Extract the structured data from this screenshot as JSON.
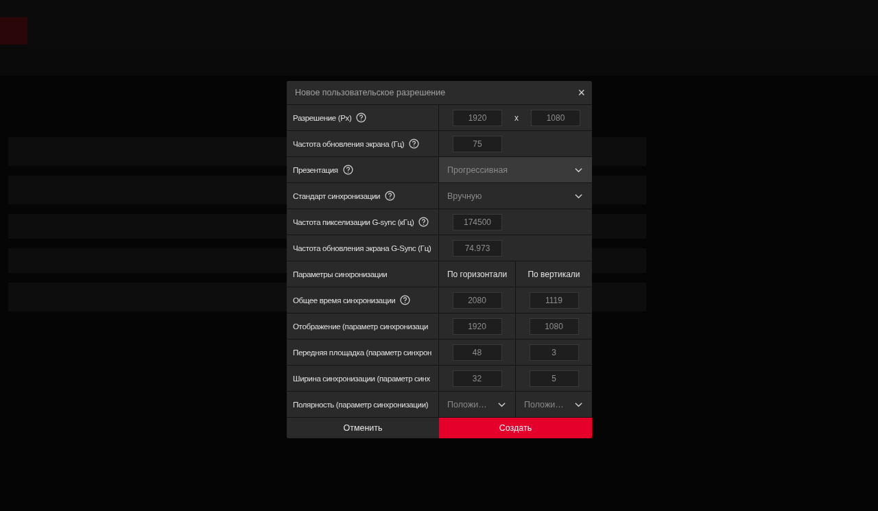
{
  "dialog": {
    "title": "Новое пользовательское разрешение",
    "close": "×",
    "rows": [
      {
        "kind": "dual",
        "label": "Разрешение (Px)",
        "help": true,
        "values": [
          "1920",
          "1080"
        ],
        "separator": "x"
      },
      {
        "kind": "input",
        "label": "Частота обновления экрана (Гц)",
        "help": true,
        "value": "75"
      },
      {
        "kind": "select",
        "label": "Презентация",
        "help": true,
        "value": "Прогрессивная",
        "highlighted": true
      },
      {
        "kind": "select",
        "label": "Стандарт синхронизации",
        "help": true,
        "value": "Вручную",
        "highlighted": false
      },
      {
        "kind": "input",
        "label": "Частота пикселизации G-sync (кГц)",
        "help": true,
        "value": "174500"
      },
      {
        "kind": "input",
        "label": "Частота обновления экрана G-Sync (Гц)",
        "help": false,
        "value": "74.973"
      },
      {
        "kind": "columns",
        "label": "Параметры синхронизации",
        "help": false,
        "headers": [
          "По горизонтали",
          "По вертикали"
        ]
      },
      {
        "kind": "pair",
        "label": "Общее время синхронизации",
        "help": true,
        "values": [
          "2080",
          "1119"
        ]
      },
      {
        "kind": "pair",
        "label": "Отображение (параметр синхронизаци",
        "help": false,
        "values": [
          "1920",
          "1080"
        ]
      },
      {
        "kind": "pair",
        "label": "Передняя площадка (параметр синхрон",
        "help": false,
        "values": [
          "48",
          "3"
        ]
      },
      {
        "kind": "pair",
        "label": "Ширина синхронизации (параметр синх",
        "help": false,
        "values": [
          "32",
          "5"
        ]
      },
      {
        "kind": "pair_select",
        "label": "Полярность (параметр синхронизации)",
        "help": false,
        "values": [
          "Положи…",
          "Положи…"
        ]
      }
    ],
    "buttons": [
      {
        "label": "Отменить",
        "kind": "secondary"
      },
      {
        "label": "Создать",
        "kind": "primary"
      }
    ]
  }
}
